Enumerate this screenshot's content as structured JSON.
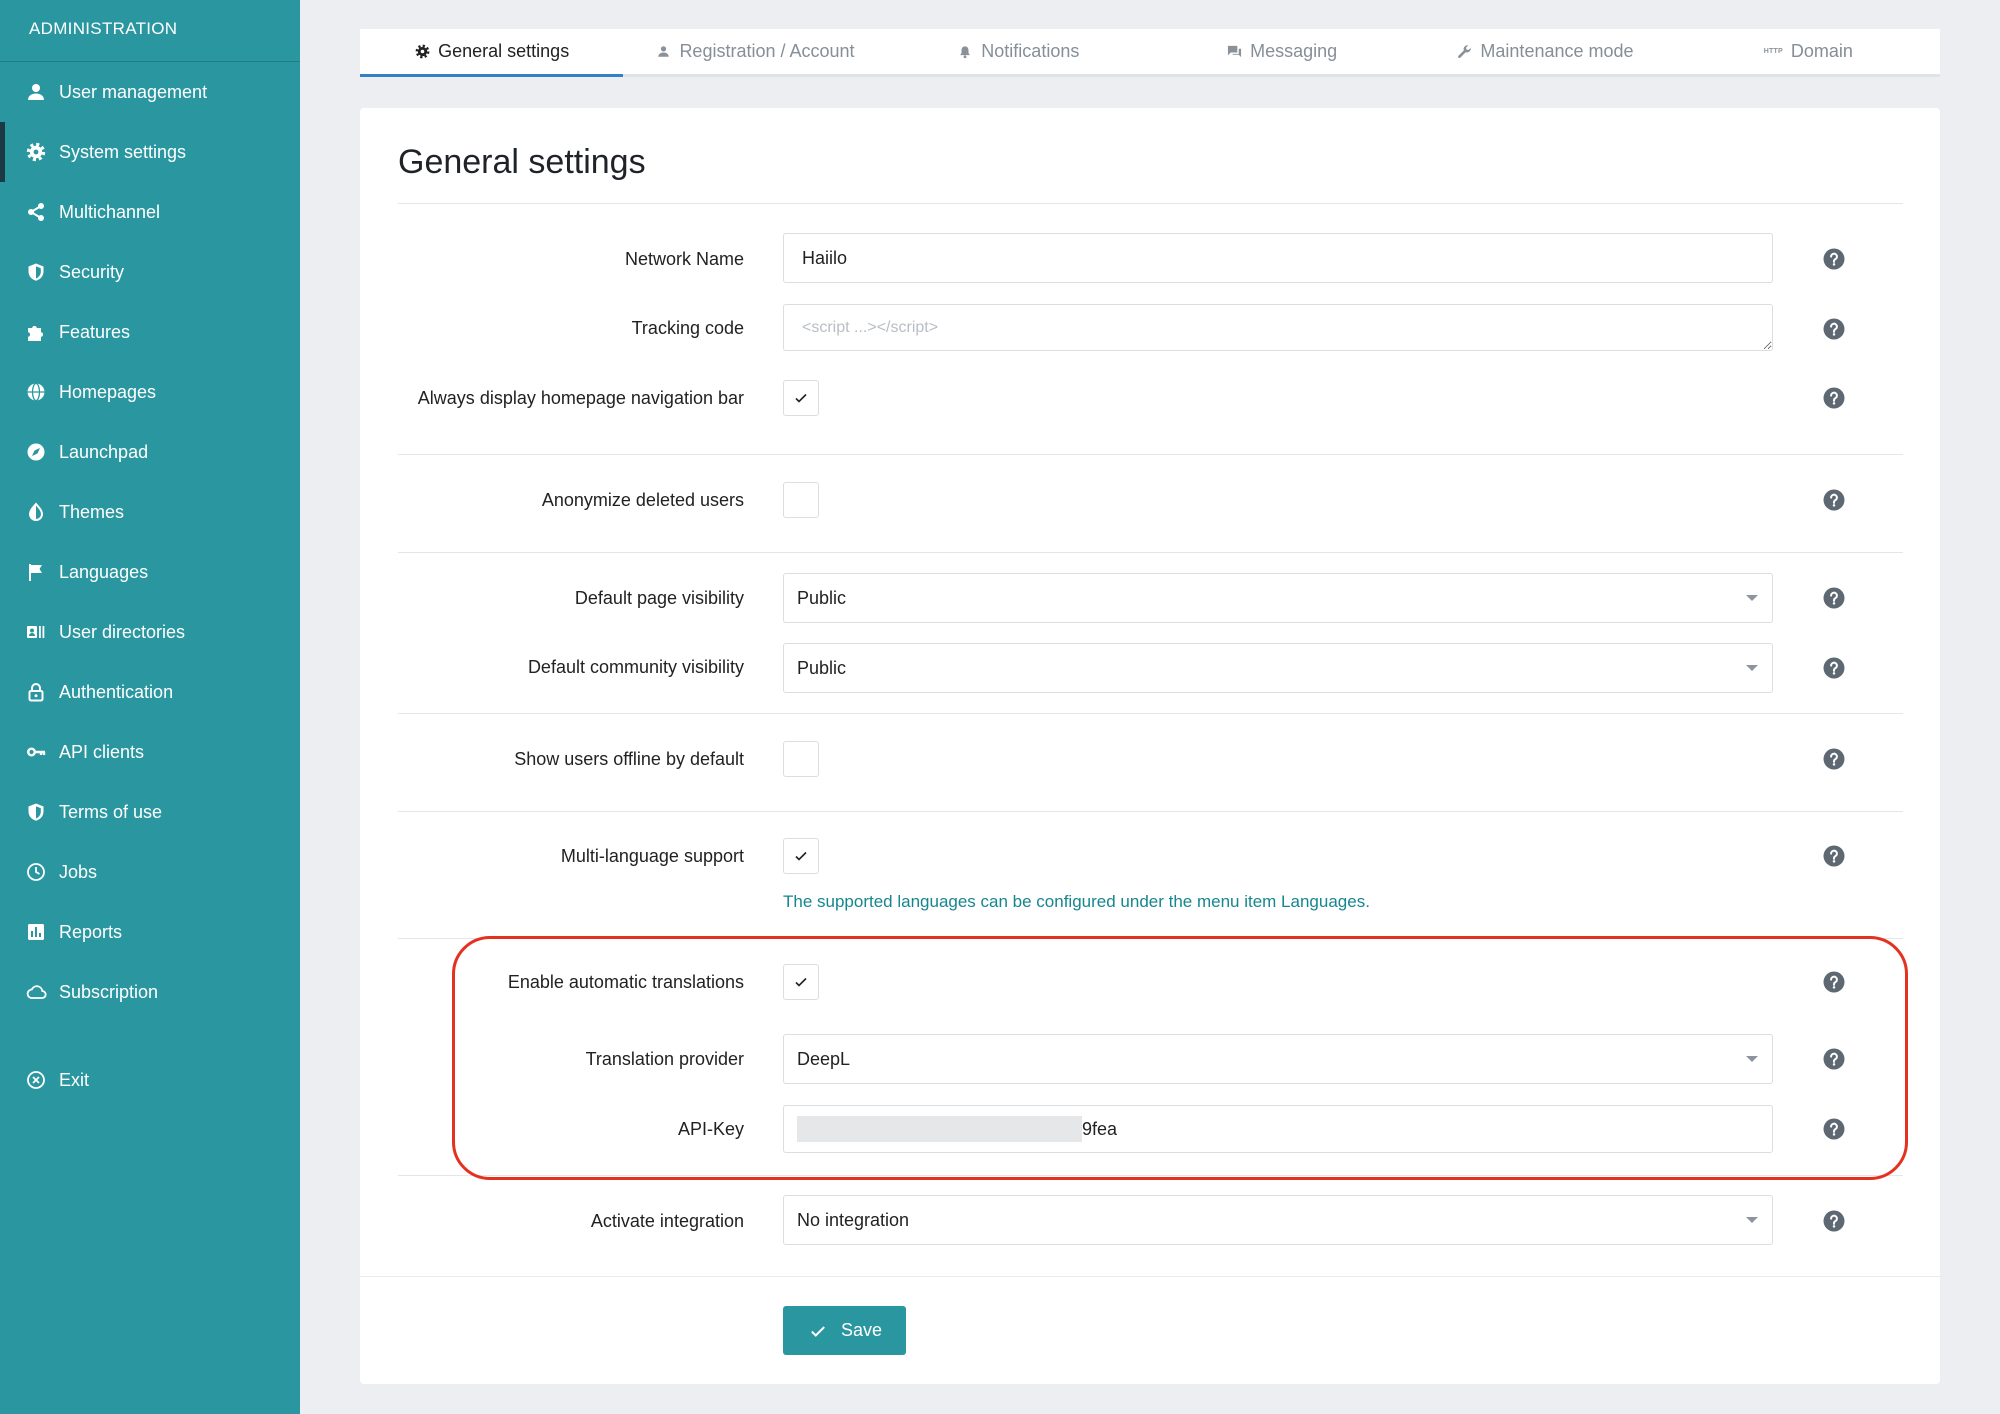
{
  "sidebar": {
    "header": "ADMINISTRATION",
    "items": [
      {
        "label": "User management",
        "icon": "user-icon"
      },
      {
        "label": "System settings",
        "icon": "gear-icon",
        "active": true
      },
      {
        "label": "Multichannel",
        "icon": "share-icon"
      },
      {
        "label": "Security",
        "icon": "shield-icon"
      },
      {
        "label": "Features",
        "icon": "puzzle-icon"
      },
      {
        "label": "Homepages",
        "icon": "globe-icon"
      },
      {
        "label": "Launchpad",
        "icon": "compass-icon"
      },
      {
        "label": "Themes",
        "icon": "theme-icon"
      },
      {
        "label": "Languages",
        "icon": "flag-icon"
      },
      {
        "label": "User directories",
        "icon": "id-card-icon"
      },
      {
        "label": "Authentication",
        "icon": "lock-icon"
      },
      {
        "label": "API clients",
        "icon": "key-icon"
      },
      {
        "label": "Terms of use",
        "icon": "shield-icon"
      },
      {
        "label": "Jobs",
        "icon": "clock-icon"
      },
      {
        "label": "Reports",
        "icon": "chart-icon"
      },
      {
        "label": "Subscription",
        "icon": "cloud-icon"
      }
    ],
    "exit": {
      "label": "Exit",
      "icon": "exit-icon"
    }
  },
  "tabs": [
    {
      "label": "General settings",
      "icon": "gear-icon",
      "active": true
    },
    {
      "label": "Registration / Account",
      "icon": "user-icon"
    },
    {
      "label": "Notifications",
      "icon": "bell-icon"
    },
    {
      "label": "Messaging",
      "icon": "chat-icon"
    },
    {
      "label": "Maintenance mode",
      "icon": "wrench-icon"
    },
    {
      "label": "Domain",
      "icon": "http-icon",
      "icon_text": "HTTP"
    }
  ],
  "page": {
    "title": "General settings"
  },
  "form": {
    "network_name": {
      "label": "Network Name",
      "value": "Haiilo"
    },
    "tracking_code": {
      "label": "Tracking code",
      "placeholder": "<script ...></script>"
    },
    "always_display_nav": {
      "label": "Always display homepage navigation bar",
      "checked": true
    },
    "anonymize_deleted_users": {
      "label": "Anonymize deleted users",
      "checked": false
    },
    "default_page_visibility": {
      "label": "Default page visibility",
      "value": "Public"
    },
    "default_community_visibility": {
      "label": "Default community visibility",
      "value": "Public"
    },
    "show_users_offline": {
      "label": "Show users offline by default",
      "checked": false
    },
    "multi_language_support": {
      "label": "Multi-language support",
      "checked": true,
      "hint": "The supported languages can be configured under the menu item Languages."
    },
    "enable_auto_translations": {
      "label": "Enable automatic translations",
      "checked": true
    },
    "translation_provider": {
      "label": "Translation provider",
      "value": "DeepL"
    },
    "api_key": {
      "label": "API-Key",
      "value_visible": "9fea",
      "redacted": true
    },
    "activate_integration": {
      "label": "Activate integration",
      "value": "No integration"
    }
  },
  "actions": {
    "save_label": "Save"
  },
  "colors": {
    "sidebar": "#2a97a0",
    "accent": "#2a97a0",
    "tab_active_underline": "#3380c4",
    "highlight_border": "#e3321f",
    "help_icon": "#5d6872",
    "link": "#16868f"
  }
}
